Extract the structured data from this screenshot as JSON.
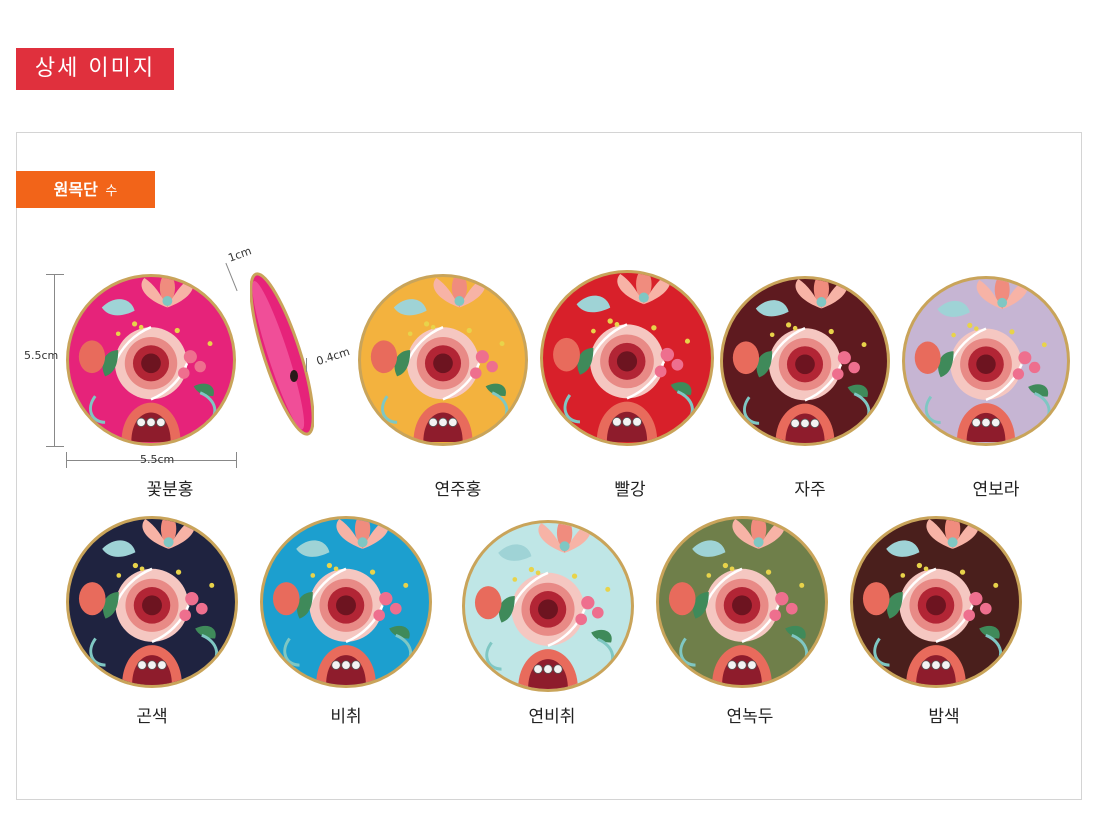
{
  "header": {
    "title": "상세 이미지"
  },
  "section": {
    "title": "원목단",
    "suffix": "수"
  },
  "dimensions": {
    "height": "5.5cm",
    "width": "5.5cm",
    "depth": "1cm",
    "thickness": "0.4cm"
  },
  "colors": {
    "header_bg": "#e0303d",
    "section_bg": "#f26419",
    "rim": "#c9a45a"
  },
  "row1": [
    {
      "name": "꽃분홍",
      "color": "#e6237a"
    },
    {
      "name": "연주홍",
      "color": "#f3b23e"
    },
    {
      "name": "빨강",
      "color": "#d8202a"
    },
    {
      "name": "자주",
      "color": "#5e1a1f"
    },
    {
      "name": "연보라",
      "color": "#c6b5d3"
    }
  ],
  "row2": [
    {
      "name": "곤색",
      "color": "#1f2340"
    },
    {
      "name": "비취",
      "color": "#1c9fcf"
    },
    {
      "name": "연비취",
      "color": "#bfe6e6"
    },
    {
      "name": "연녹두",
      "color": "#6f7f4a"
    },
    {
      "name": "밤색",
      "color": "#4a1f1c"
    }
  ]
}
